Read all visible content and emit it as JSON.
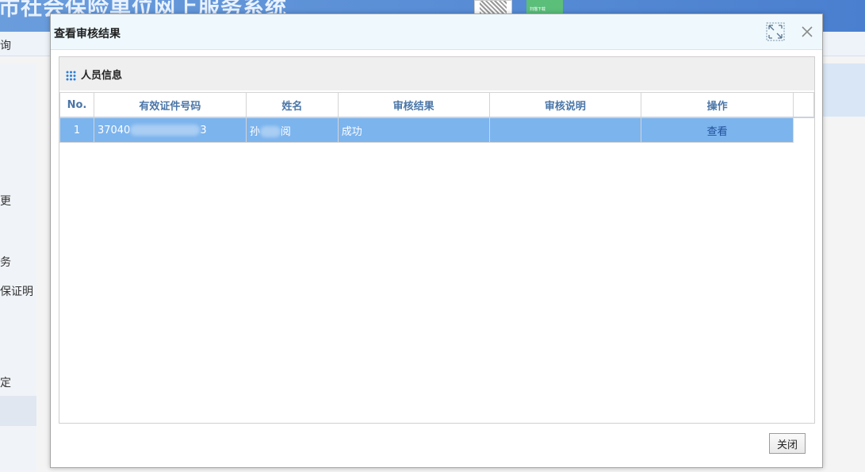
{
  "app": {
    "title_fragment": "市社会保险单位网上服务系统",
    "menu_fragment": "询",
    "qr_caption": "扫描下载"
  },
  "left_nav": {
    "items": [
      "更",
      "务",
      "保证明",
      "定"
    ]
  },
  "dialog": {
    "title": "查看审核结果",
    "close_label": "关闭",
    "panel": {
      "title": "人员信息",
      "columns": [
        "No.",
        "有效证件号码",
        "姓名",
        "审核结果",
        "审核说明",
        "操作"
      ],
      "rows": [
        {
          "no": "1",
          "id_number_visible_prefix": "37040",
          "id_number_visible_suffix": "3",
          "name_visible_prefix": "孙",
          "name_visible_suffix": "阅",
          "result": "成功",
          "remark": "",
          "action": "查看"
        }
      ]
    }
  },
  "colors": {
    "selected_row": "#7cb4ee",
    "header_text": "#4a76a8",
    "title_bar": "#eff9fd"
  }
}
